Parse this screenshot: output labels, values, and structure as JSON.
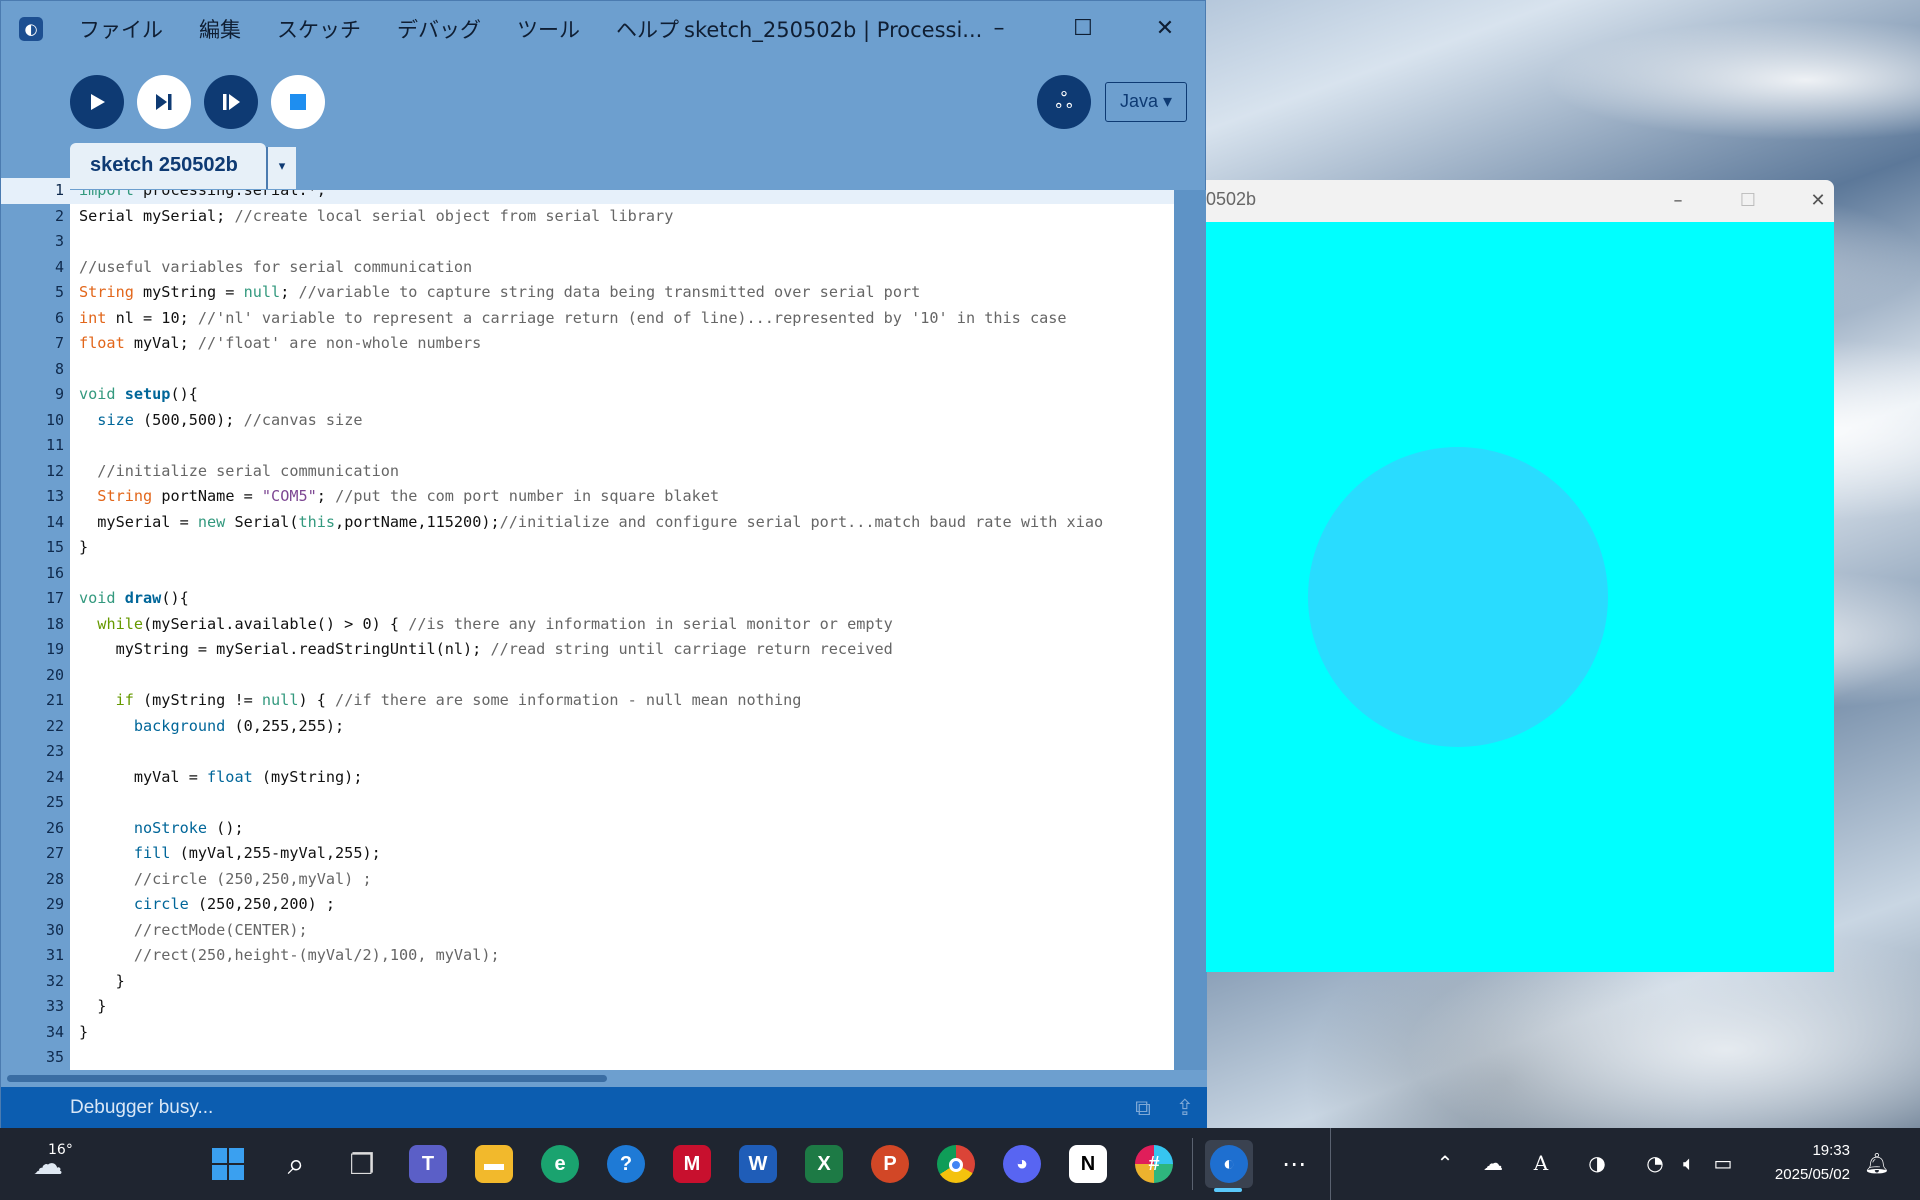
{
  "window": {
    "title": "sketch_250502b | Processi...",
    "menu": [
      "ファイル",
      "編集",
      "スケッチ",
      "デバッグ",
      "ツール",
      "ヘルプ"
    ]
  },
  "toolbar": {
    "mode": "Java ▾"
  },
  "tab": {
    "name": "sketch 250502b",
    "menu_arrow": "▾"
  },
  "editor": {
    "current_line": 1,
    "line_numbers": [
      "1",
      "2",
      "3",
      "4",
      "5",
      "6",
      "7",
      "8",
      "9",
      "10",
      "11",
      "12",
      "13",
      "14",
      "15",
      "16",
      "17",
      "18",
      "19",
      "20",
      "21",
      "22",
      "23",
      "24",
      "25",
      "26",
      "27",
      "28",
      "29",
      "30",
      "31",
      "32",
      "33",
      "34",
      "35"
    ],
    "lines": [
      "import processing.serial.*;",
      "Serial mySerial; //create local serial object from serial library",
      "",
      "//useful variables for serial communication",
      "String myString = null; //variable to capture string data being transmitted over serial port",
      "int nl = 10; //'nl' variable to represent a carriage return (end of line)...represented by '10' in this case",
      "float myVal; //'float' are non-whole numbers",
      "",
      "void setup(){",
      "  size (500,500); //canvas size",
      "",
      "  //initialize serial communication",
      "  String portName = \"COM5\"; //put the com port number in square blaket",
      "  mySerial = new Serial(this,portName,115200);//initialize and configure serial port...match baud rate with xiao",
      "}",
      "",
      "void draw(){",
      "  while(mySerial.available() > 0) { //is there any information in serial monitor or empty",
      "    myString = mySerial.readStringUntil(nl); //read string until carriage return received",
      "",
      "    if (myString != null) { //if there are some information - null mean nothing",
      "      background (0,255,255);",
      "",
      "      myVal = float (myString);",
      "",
      "      noStroke ();",
      "      fill (myVal,255-myVal,255);",
      "      //circle (250,250,myVal) ;",
      "      circle (250,250,200) ;",
      "      //rectMode(CENTER);",
      "      //rect(250,height-(myVal/2),100, myVal);",
      "    }",
      "  }",
      "}",
      ""
    ]
  },
  "status": {
    "text": "Debugger busy..."
  },
  "sketch_window": {
    "title": "0502b",
    "background_color": "#00ffff",
    "circle_color": "#29dcff"
  },
  "taskbar": {
    "weather_temp": "16°",
    "clock_time": "19:33",
    "clock_date": "2025/05/02",
    "apps": [
      "start-icon",
      "search-icon",
      "task-view-icon",
      "teams-icon",
      "file-explorer-icon",
      "edge-icon",
      "help-icon",
      "mcafee-icon",
      "word-icon",
      "excel-icon",
      "powerpoint-icon",
      "chrome-icon",
      "discord-icon",
      "notion-icon",
      "slack-icon",
      "processing-icon"
    ]
  }
}
